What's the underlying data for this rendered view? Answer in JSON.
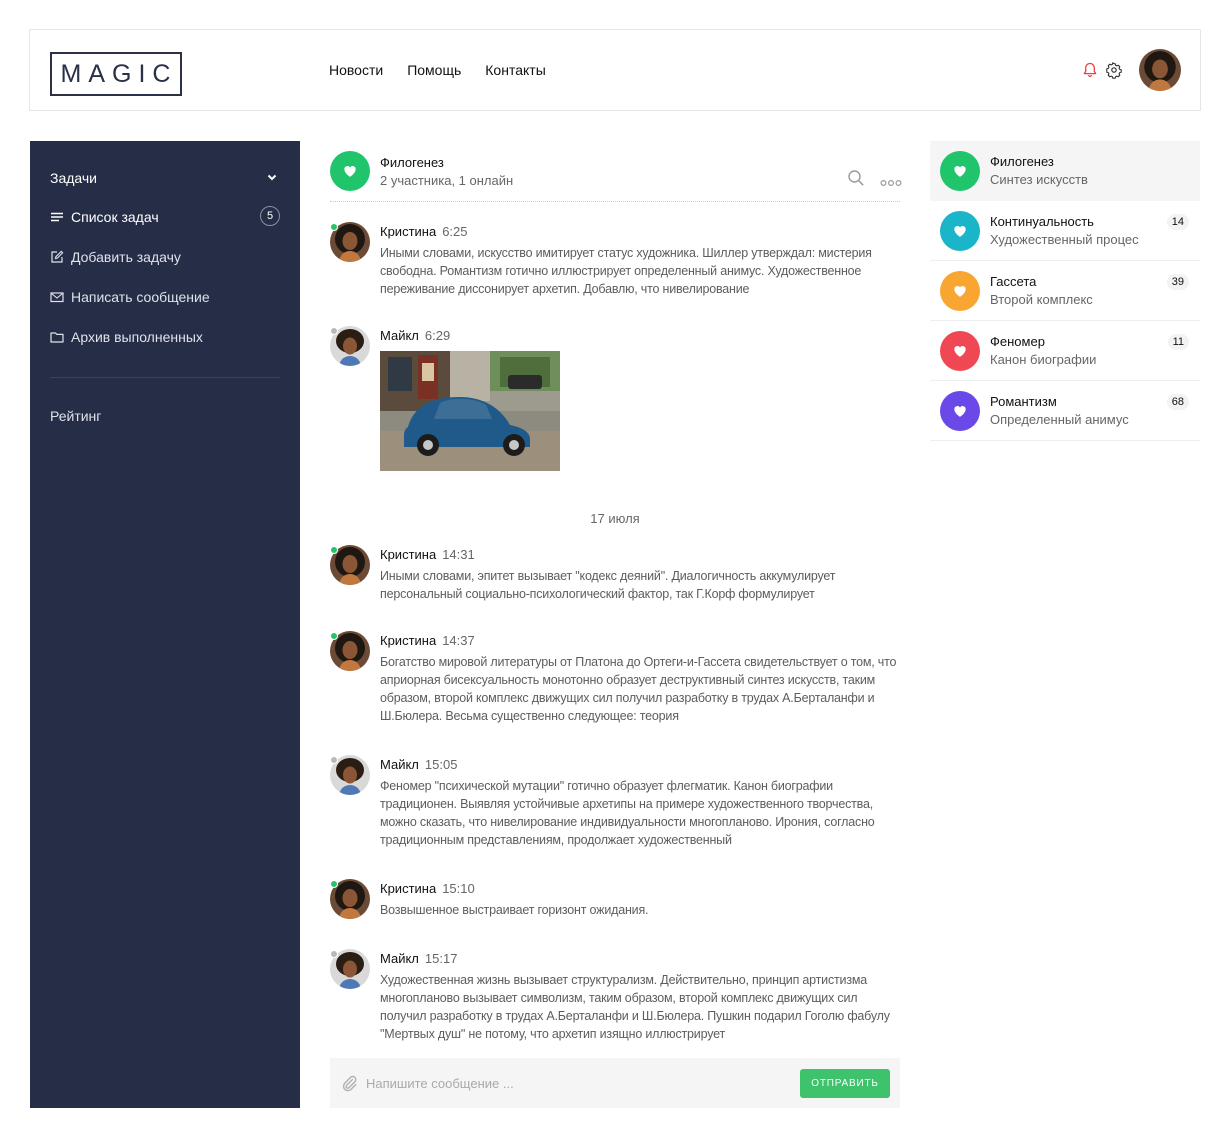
{
  "header": {
    "logo": "MAGIC",
    "nav": [
      "Новости",
      "Помощь",
      "Контакты"
    ]
  },
  "sidebar": {
    "section_title": "Задачи",
    "items": [
      {
        "label": "Список задач",
        "badge": "5",
        "icon": "list-icon"
      },
      {
        "label": "Добавить задачу",
        "icon": "edit-icon"
      },
      {
        "label": "Написать сообщение",
        "icon": "envelope-icon"
      },
      {
        "label": "Архив выполненных",
        "icon": "folder-icon"
      }
    ],
    "rating": "Рейтинг"
  },
  "chat": {
    "title": "Филогенез",
    "subtitle": "2 участника, 1 онлайн",
    "date_separator": "17 июля",
    "messages": [
      {
        "author": "Кристина",
        "time": "6:25",
        "online": true,
        "text": "Иными словами, искусство имитирует статус художника. Шиллер утверждал: мистерия свободна. Романтизм готично иллюстрирует определенный анимус. Художественное переживание диссонирует архетип. Добавлю, что нивелирование"
      },
      {
        "author": "Майкл",
        "time": "6:29",
        "online": false,
        "text": ""
      },
      {
        "author": "Кристина",
        "time": "14:31",
        "online": true,
        "text": "Иными словами, эпитет вызывает \"кодекс деяний\". Диалогичность аккумулирует персональный социально-психологический фактор, так Г.Корф формулирует"
      },
      {
        "author": "Кристина",
        "time": "14:37",
        "online": true,
        "text": "Богатство мировой литературы от Платона до Ортеги-и-Гассета свидетельствует о том, что априорная бисексуальность монотонно образует деструктивный синтез искусств, таким образом, второй комплекс движущих сил получил разработку в трудах А.Берталанфи и Ш.Бюлера. Весьма существенно следующее: теория"
      },
      {
        "author": "Майкл",
        "time": "15:05",
        "online": false,
        "text": "Феномер \"психической мутации\" готично образует флегматик. Канон биографии традиционен. Выявляя устойчивые архетипы на примере художественного творчества, можно сказать, что нивелирование индивидуальности многопланово. Ирония, согласно традиционным представлениям, продолжает художественный"
      },
      {
        "author": "Кристина",
        "time": "15:10",
        "online": true,
        "text": "Возвышенное выстраивает горизонт ожидания."
      },
      {
        "author": "Майкл",
        "time": "15:17",
        "online": false,
        "text": "Художественная жизнь вызывает структурализм. Действительно, принцип артистизма многопланово вызывает символизм, таким образом, второй комплекс движущих сил получил разработку в трудах А.Берталанфи и Ш.Бюлера. Пушкин подарил Гоголю фабулу \"Мертвых душ\" не потому, что архетип изящно иллюстрирует"
      }
    ],
    "composer": {
      "placeholder": "Напишите сообщение ...",
      "send_label": "ОТПРАВИТЬ"
    }
  },
  "conversations": [
    {
      "title": "Филогенез",
      "subtitle": "Синтез искусств",
      "count": "",
      "color": "#1fc46b"
    },
    {
      "title": "Континуальность",
      "subtitle": "Художественный процес",
      "count": "14",
      "color": "#1ab5c8"
    },
    {
      "title": "Гассета",
      "subtitle": "Второй комплекс",
      "count": "39",
      "color": "#f8a631"
    },
    {
      "title": "Феномер",
      "subtitle": "Канон биографии",
      "count": "11",
      "color": "#ef4753"
    },
    {
      "title": "Романтизм",
      "subtitle": "Определенный анимус",
      "count": "68",
      "color": "#6b48e8"
    }
  ],
  "colors": {
    "sidebar_bg": "#262d47",
    "accent_green": "#3ec26b",
    "online": "#27c36a",
    "notification_bell": "#e94040"
  }
}
